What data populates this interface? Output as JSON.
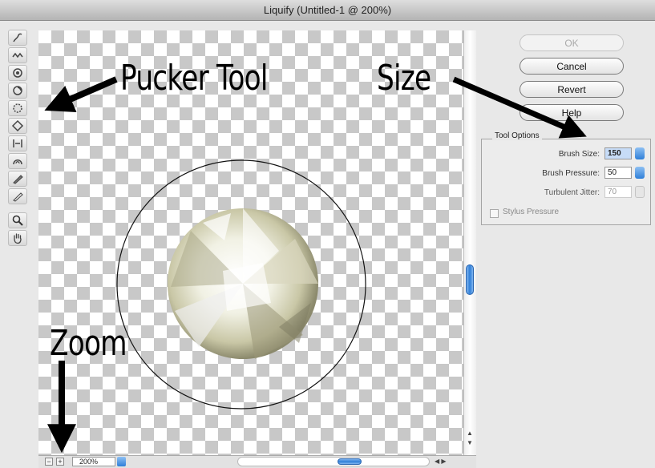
{
  "window": {
    "title": "Liquify (Untitled-1 @ 200%)"
  },
  "toolbar": {
    "tools": [
      "forward-warp-tool-icon",
      "reconstruct-tool-icon",
      "twirl-clockwise-tool-icon",
      "pucker-tool-icon",
      "bloat-tool-icon",
      "push-left-tool-icon",
      "mirror-tool-icon",
      "turbulence-tool-icon",
      "freeze-mask-tool-icon",
      "thaw-mask-tool-icon",
      "zoom-tool-icon",
      "hand-tool-icon"
    ]
  },
  "buttons": {
    "ok": "OK",
    "cancel": "Cancel",
    "revert": "Revert",
    "help": "Help"
  },
  "tool_options": {
    "legend": "Tool Options",
    "brush_size_label": "Brush Size:",
    "brush_size_value": "150",
    "brush_pressure_label": "Brush Pressure:",
    "brush_pressure_value": "50",
    "turbulent_jitter_label": "Turbulent Jitter:",
    "turbulent_jitter_value": "70",
    "stylus_pressure_label": "Stylus Pressure",
    "stylus_pressure_checked": false
  },
  "bottom": {
    "zoom_minus": "−",
    "zoom_plus": "+",
    "zoom_value": "200%"
  },
  "annotations": {
    "pucker": "Pucker Tool",
    "size": "Size",
    "zoom": "Zoom"
  },
  "colors": {
    "accent": "#2f7fd8",
    "canvas_check": "#c8c8c8",
    "annotation": "#000000"
  }
}
